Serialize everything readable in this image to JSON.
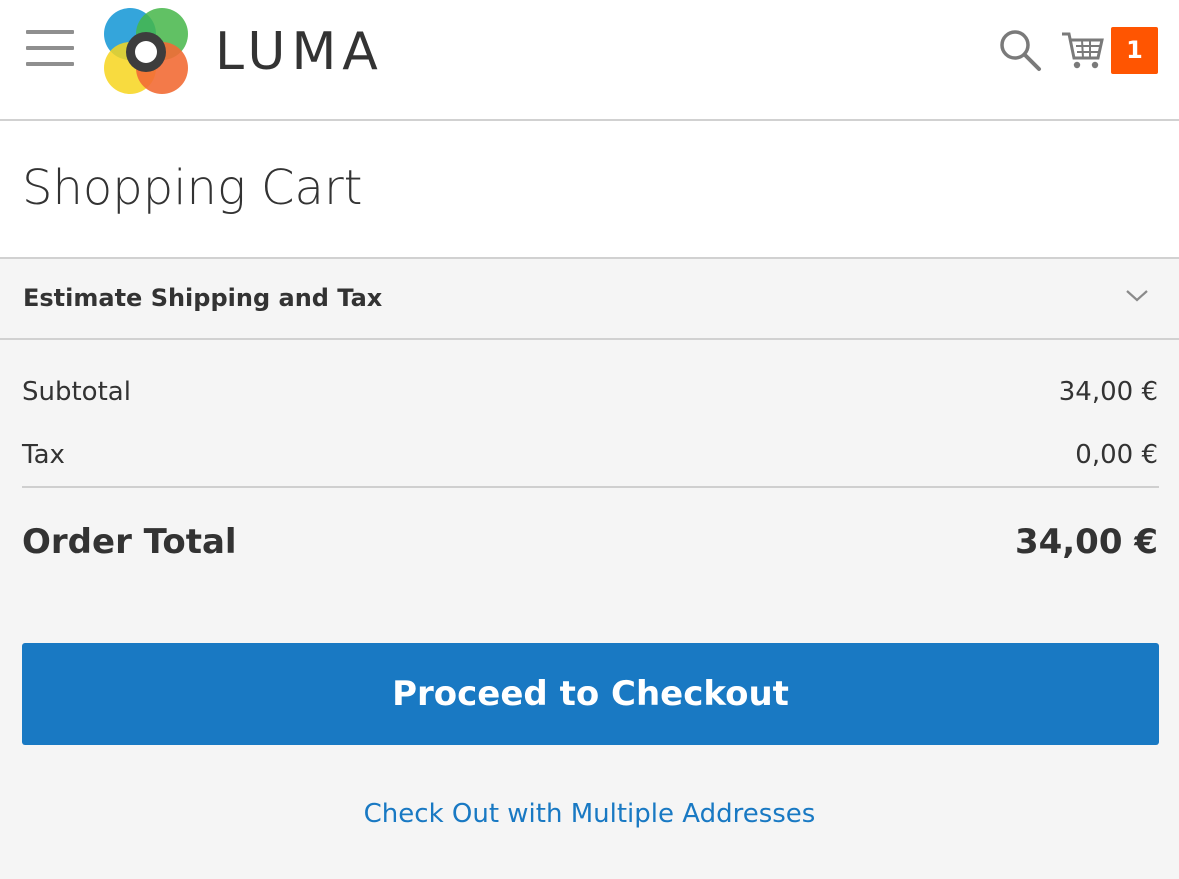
{
  "header": {
    "brand": "LUMA",
    "cart_count": "1",
    "icons": {
      "menu": "hamburger-menu-icon",
      "logo": "luma-logo",
      "search": "search-icon",
      "cart": "shopping-cart-icon"
    },
    "colors": {
      "badge": "#ff5501",
      "accent": "#1979c3"
    }
  },
  "page": {
    "title": "Shopping Cart"
  },
  "estimate": {
    "label": "Estimate Shipping and Tax",
    "icon": "chevron-down-icon"
  },
  "summary": {
    "subtotal_label": "Subtotal",
    "subtotal_value": "34,00 €",
    "tax_label": "Tax",
    "tax_value": "0,00 €",
    "order_total_label": "Order Total",
    "order_total_value": "34,00 €"
  },
  "actions": {
    "checkout_label": "Proceed to Checkout",
    "multi_address_label": "Check Out with Multiple Addresses"
  }
}
